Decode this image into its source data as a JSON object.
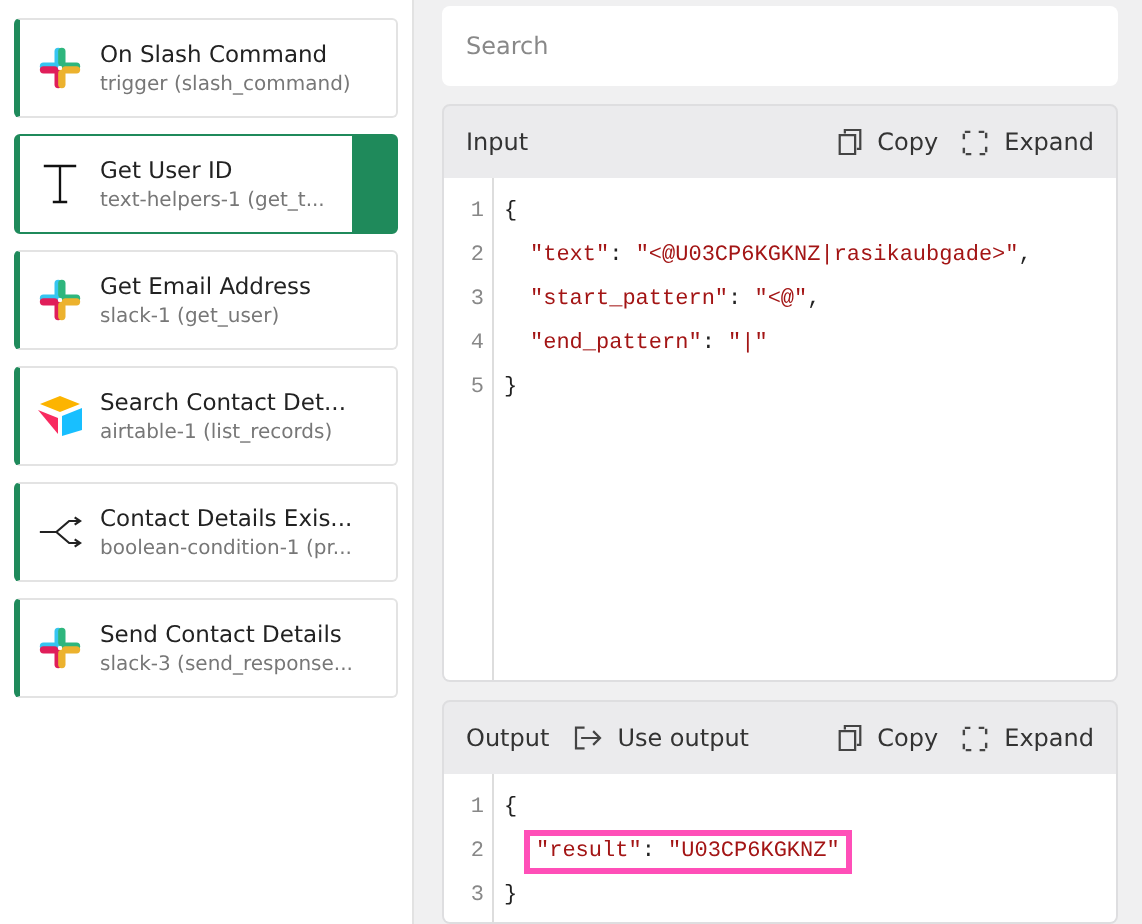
{
  "steps": [
    {
      "kind": "slack",
      "title": "On Slash Command",
      "subtitle": "trigger (slash_command)",
      "selected": false
    },
    {
      "kind": "text",
      "title": "Get User ID",
      "subtitle": "text-helpers-1 (get_t...",
      "selected": true
    },
    {
      "kind": "slack",
      "title": "Get Email Address",
      "subtitle": "slack-1 (get_user)",
      "selected": false
    },
    {
      "kind": "airtable",
      "title": "Search Contact Det...",
      "subtitle": "airtable-1 (list_records)",
      "selected": false
    },
    {
      "kind": "branch",
      "title": "Contact Details Exis...",
      "subtitle": "boolean-condition-1 (pr...",
      "selected": false
    },
    {
      "kind": "slack",
      "title": "Send Contact Details",
      "subtitle": "slack-3 (send_response...",
      "selected": false
    }
  ],
  "search": {
    "placeholder": "Search"
  },
  "panels": [
    {
      "title": "Input",
      "copy": "Copy",
      "expand": "Expand",
      "lines": [
        {
          "number": "1",
          "highlighted": false,
          "tokens": [
            {
              "kind": "punct",
              "text": "{"
            }
          ]
        },
        {
          "number": "2",
          "highlighted": false,
          "tokens": [
            {
              "kind": "str",
              "text": "\"text\""
            },
            {
              "kind": "punct",
              "text": ": "
            },
            {
              "kind": "str",
              "text": "\"<@U03CP6KGKNZ|rasikaubgade>\""
            },
            {
              "kind": "punct",
              "text": ","
            }
          ]
        },
        {
          "number": "3",
          "highlighted": false,
          "tokens": [
            {
              "kind": "str",
              "text": "\"start_pattern\""
            },
            {
              "kind": "punct",
              "text": ": "
            },
            {
              "kind": "str",
              "text": "\"<@\""
            },
            {
              "kind": "punct",
              "text": ","
            }
          ]
        },
        {
          "number": "4",
          "highlighted": false,
          "tokens": [
            {
              "kind": "str",
              "text": "\"end_pattern\""
            },
            {
              "kind": "punct",
              "text": ": "
            },
            {
              "kind": "str",
              "text": "\"|\""
            }
          ]
        },
        {
          "number": "5",
          "highlighted": false,
          "tokens": [
            {
              "kind": "punct",
              "text": "}"
            }
          ]
        }
      ]
    },
    {
      "title": "Output",
      "use_output": "Use output",
      "copy": "Copy",
      "expand": "Expand",
      "lines": [
        {
          "number": "1",
          "highlighted": false,
          "tokens": [
            {
              "kind": "punct",
              "text": "{"
            }
          ]
        },
        {
          "number": "2",
          "highlighted": true,
          "tokens": [
            {
              "kind": "str",
              "text": "\"result\""
            },
            {
              "kind": "punct",
              "text": ": "
            },
            {
              "kind": "str",
              "text": "\"U03CP6KGKNZ\""
            }
          ]
        },
        {
          "number": "3",
          "highlighted": false,
          "tokens": [
            {
              "kind": "punct",
              "text": "}"
            }
          ]
        }
      ]
    }
  ]
}
